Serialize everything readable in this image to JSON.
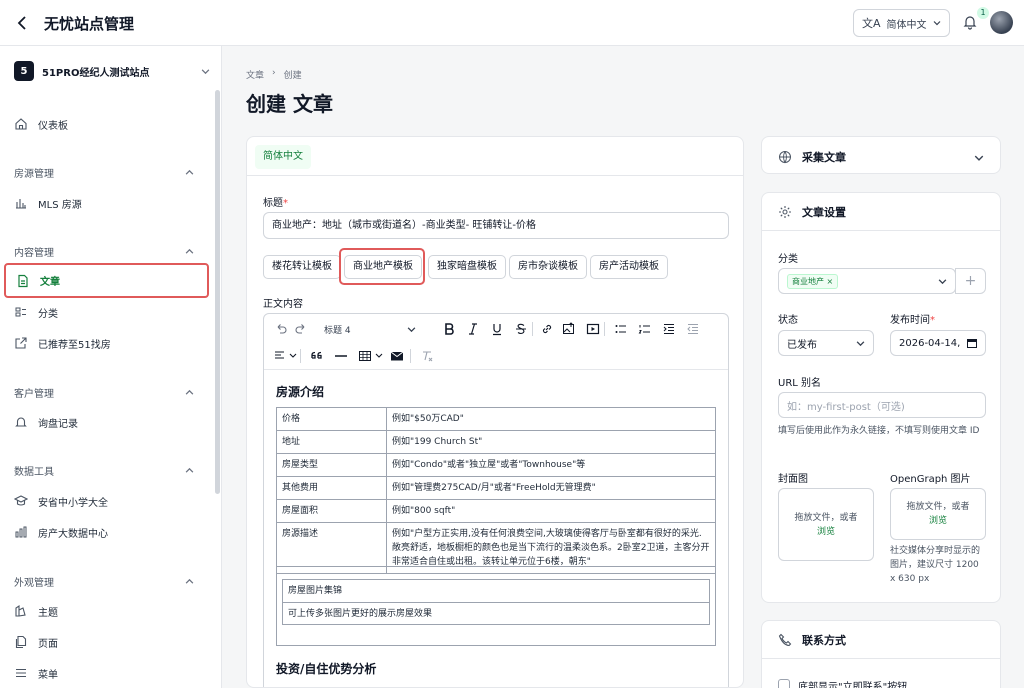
{
  "app": {
    "title": "无忧站点管理",
    "language": "简体中文",
    "notification_count": "1"
  },
  "sidebar": {
    "site_id": "5",
    "site_name": "51PRO经纪人测试站点",
    "dashboard": "仪表板",
    "sections": {
      "property": "房源管理",
      "content": "内容管理",
      "customer": "客户管理",
      "data_tools": "数据工具",
      "appearance": "外观管理"
    },
    "items": {
      "mls": "MLS 房源",
      "articles": "文章",
      "categories": "分类",
      "recommended": "已推荐至51找房",
      "inquiries": "询盘记录",
      "schools": "安省中小学大全",
      "big_data": "房产大数据中心",
      "themes": "主题",
      "pages": "页面",
      "menus": "菜单"
    }
  },
  "breadcrumb": {
    "parent": "文章",
    "current": "创建"
  },
  "page_title": "创建 文章",
  "editor": {
    "lang_tab": "简体中文",
    "title_label": "标题",
    "title_value": "商业地产：地址（城市或街道名）-商业类型- 旺铺转让-价格",
    "templates": [
      "楼花转让模板",
      "商业地产模板",
      "独家暗盘模板",
      "房市杂谈模板",
      "房产活动模板"
    ],
    "body_label": "正文内容",
    "heading_select": "标题 4",
    "section1_title": "房源介绍",
    "rows": [
      {
        "k": "价格",
        "v": "例如\"$50万CAD\""
      },
      {
        "k": "地址",
        "v": "例如\"199 Church St\""
      },
      {
        "k": "房屋类型",
        "v": "例如\"Condo\"或者\"独立屋\"或者\"Townhouse\"等"
      },
      {
        "k": "其他费用",
        "v": "例如\"管理费275CAD/月\"或者\"FreeHold无管理费\""
      },
      {
        "k": "房屋面积",
        "v": "例如\"800 sqft\""
      },
      {
        "k": "房源描述",
        "v": "例如\"户型方正实用,没有任何浪费空间,大玻璃使得客厅与卧室都有很好的采光.敞亮舒适，地板橱柜的颜色也是当下流行的温柔淡色系。2卧室2卫道，主客分开非常适合自住或出租。该转让单元位于6楼，朝东\""
      }
    ],
    "gallery_title": "房屋图片集锦",
    "gallery_hint": "可上传多张图片更好的展示房屋效果",
    "section2_title": "投资/自住优势分析"
  },
  "right": {
    "collect_title": "采集文章",
    "settings_title": "文章设置",
    "category_label": "分类",
    "category_tag": "商业地产",
    "status_label": "状态",
    "status_value": "已发布",
    "publish_label": "发布时间",
    "publish_value": "2026-04-14,",
    "slug_label": "URL 别名",
    "slug_placeholder": "如：my-first-post（可选)",
    "slug_hint": "填写后使用此作为永久链接，不填写则使用文章 ID",
    "cover_label": "封面图",
    "og_label": "OpenGraph 图片",
    "drop_text": "拖放文件，或者",
    "drop_link": "浏览",
    "og_hint": "社交媒体分享时显示的图片，建议尺寸 1200 x 630 px",
    "contact_title": "联系方式",
    "contact_checkbox": "底部显示\"立即联系\"按钮"
  },
  "colors": {
    "accent": "#15803d",
    "highlight": "#e05a5a"
  }
}
